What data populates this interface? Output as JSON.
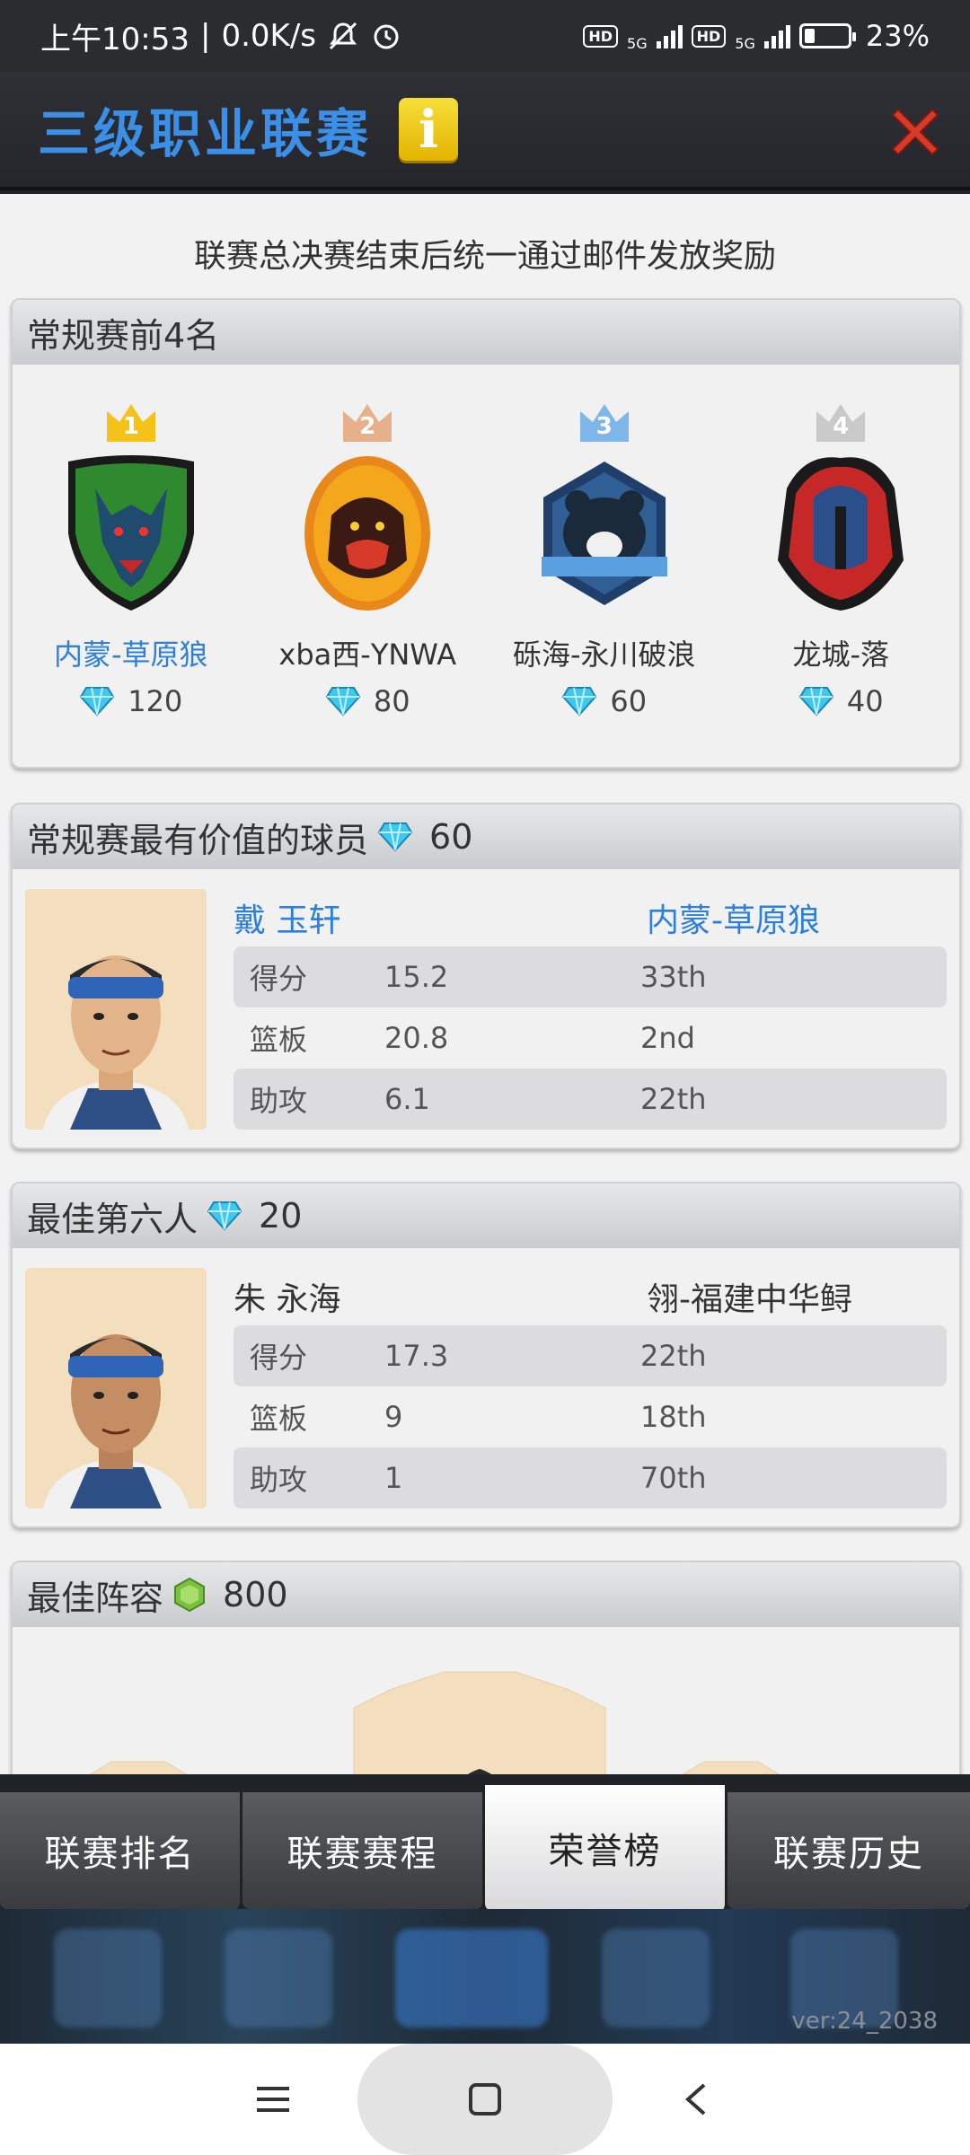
{
  "status_bar": {
    "time": "上午10:53",
    "net_speed": "0.0K/s",
    "battery": "23%",
    "battery_level": 0.23,
    "hd_label": "HD",
    "net_type": "5G"
  },
  "header": {
    "title": "三级职业联赛",
    "info_icon": "i"
  },
  "notice": "联赛总决赛结束后统一通过邮件发放奖励",
  "top4": {
    "heading": "常规赛前4名",
    "teams": [
      {
        "rank": "1",
        "name": "内蒙-草原狼",
        "reward": "120",
        "crown_color": "#f5c21a",
        "logo": "wolf-logo-icon"
      },
      {
        "rank": "2",
        "name": "xba西-YNWA",
        "reward": "80",
        "crown_color": "#e6b08a",
        "logo": "gorilla-logo-icon"
      },
      {
        "rank": "3",
        "name": "砾海-永川破浪",
        "reward": "60",
        "crown_color": "#7fb6ea",
        "logo": "bear-logo-icon"
      },
      {
        "rank": "4",
        "name": "龙城-落",
        "reward": "40",
        "crown_color": "#c9c9c9",
        "logo": "spartan-logo-icon"
      }
    ]
  },
  "mvp": {
    "heading": "常规赛最有价值的球员",
    "reward": "60",
    "player_name": "戴 玉轩",
    "team": "内蒙-草原狼",
    "stats": [
      {
        "label": "得分",
        "value": "15.2",
        "rank": "33th"
      },
      {
        "label": "篮板",
        "value": "20.8",
        "rank": "2nd"
      },
      {
        "label": "助攻",
        "value": "6.1",
        "rank": "22th"
      }
    ]
  },
  "sixth_man": {
    "heading": "最佳第六人",
    "reward": "20",
    "player_name": "朱 永海",
    "team": "翎-福建中华鲟",
    "stats": [
      {
        "label": "得分",
        "value": "17.3",
        "rank": "22th"
      },
      {
        "label": "篮板",
        "value": "9",
        "rank": "18th"
      },
      {
        "label": "助攻",
        "value": "1",
        "rank": "70th"
      }
    ]
  },
  "lineup": {
    "heading": "最佳阵容",
    "reward": "800"
  },
  "tabs": [
    {
      "label": "联赛排名",
      "active": false
    },
    {
      "label": "联赛赛程",
      "active": false
    },
    {
      "label": "荣誉榜",
      "active": true
    },
    {
      "label": "联赛历史",
      "active": false
    }
  ],
  "version": "ver:24_2038",
  "colors": {
    "accent_blue": "#2c7fdc",
    "title_blue": "#3b8fe6",
    "close_red": "#d83a2a",
    "gem_cyan": "#3ec8ef",
    "token_green": "#7bc043"
  }
}
